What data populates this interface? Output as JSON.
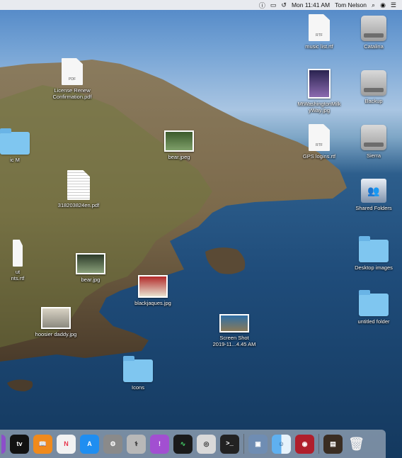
{
  "menubar": {
    "status_icons": [
      "siri-icon",
      "display-icon",
      "time-machine-icon"
    ],
    "datetime": "Mon 11:41 AM",
    "user": "Tom Nelson",
    "right_icons": [
      "search-icon",
      "control-center-icon",
      "notification-list-icon"
    ]
  },
  "desktop_icons": {
    "license": "License Renew\nConfirmation.pdf",
    "license_tag": "PDF",
    "bear1": "bear.jpeg",
    "music_m": "ic M",
    "pdf2": "318203824en.pdf",
    "ut": "ut\nnts.rtf",
    "bear2": "bear.jpg",
    "blackjaques": "blackjaques.jpg",
    "hoosier": "hoosier daddy.jpg",
    "screenshot": "Screen Shot\n2019-11...4.45 AM",
    "icons_folder": "Icons",
    "music_list": "music list.rtf",
    "music_list_tag": "RTF",
    "mtwashington": "MtWashingtonMilk\nyWay.jpg",
    "gps": "GPS logins.rtf",
    "gps_tag": "RTF",
    "catalina": "Catalina",
    "backup": "Backup",
    "sierra": "Sierra",
    "shared": "Shared Folders",
    "desktop_images": "Desktop images",
    "untitled": "untitled folder"
  },
  "dock": {
    "apps": [
      "apple-tv-icon",
      "books-icon",
      "news-icon",
      "app-store-icon",
      "system-preferences-icon",
      "disk-utility-icon",
      "feedback-icon",
      "activity-monitor-icon",
      "screenshot-icon",
      "terminal-icon",
      "preview-icon",
      "finder-icon",
      "photobooth-icon",
      "photo-slideshow-icon",
      "trash-icon"
    ],
    "apple_tv_label": "tv"
  },
  "colors": {
    "folder": "#7fc6f0",
    "menubar": "#eeeef0",
    "ocean": "#1f4c7a"
  }
}
